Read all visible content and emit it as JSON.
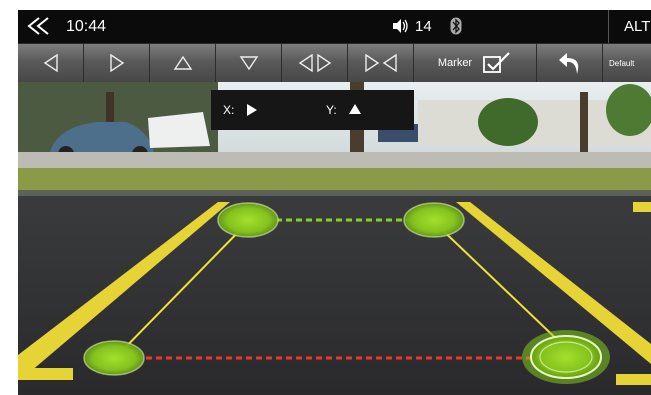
{
  "status_bar": {
    "time": "10:44",
    "volume": "14",
    "alt_label": "ALT",
    "icons": [
      "double-chevron-back-icon",
      "speaker-icon",
      "bluetooth-icon"
    ]
  },
  "toolbar": {
    "buttons": [
      {
        "name": "move-left",
        "icon": "triangle-left-icon"
      },
      {
        "name": "move-right",
        "icon": "triangle-right-icon"
      },
      {
        "name": "move-up",
        "icon": "triangle-up-icon"
      },
      {
        "name": "move-down",
        "icon": "triangle-down-icon"
      },
      {
        "name": "widen",
        "icon": "spread-horizontal-icon"
      },
      {
        "name": "narrow",
        "icon": "pinch-horizontal-icon"
      }
    ],
    "marker_label": "Marker",
    "marker_checked": true,
    "undo_icon": "undo-arrow-icon",
    "default_label": "Default"
  },
  "overlay": {
    "x_label": "X:",
    "y_label": "Y:",
    "x_icon": "triangle-right-icon",
    "y_icon": "triangle-up-icon"
  },
  "colors": {
    "marker_fill": "#84c21e",
    "line_near": "#e83a2a",
    "line_far": "#8cd021",
    "guide_yellow": "#f2e03a"
  }
}
